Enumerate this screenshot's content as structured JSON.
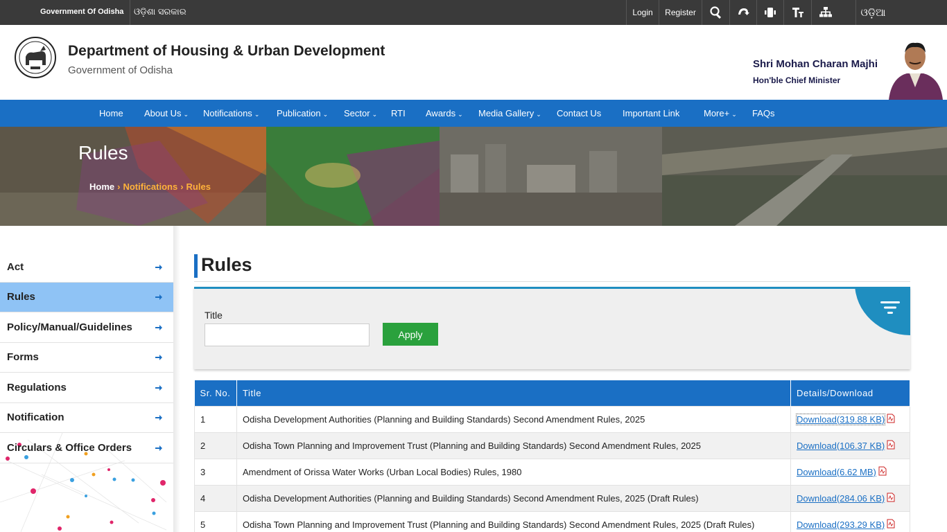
{
  "topbar": {
    "gov_english": "Government Of Odisha",
    "gov_odia": "ଓଡ଼ିଶା ସରକାର",
    "login": "Login",
    "register": "Register",
    "language": "ଓଡ଼ିଆ"
  },
  "header": {
    "title": "Department of Housing & Urban Development",
    "subtitle": "Government of Odisha",
    "cm_name": "Shri Mohan Charan Majhi",
    "cm_title": "Hon'ble Chief Minister"
  },
  "nav": {
    "items": [
      {
        "label": "Home"
      },
      {
        "label": "About Us"
      },
      {
        "label": "Notifications"
      },
      {
        "label": "Publication"
      },
      {
        "label": "Sector"
      },
      {
        "label": "RTI"
      },
      {
        "label": "Awards"
      },
      {
        "label": "Media Gallery"
      },
      {
        "label": "Contact Us"
      },
      {
        "label": "Important Link"
      },
      {
        "label": "More+"
      },
      {
        "label": "FAQs"
      }
    ]
  },
  "banner": {
    "title": "Rules",
    "breadcrumb": [
      "Home",
      "Notifications",
      "Rules"
    ]
  },
  "sidebar": {
    "items": [
      {
        "label": "Act"
      },
      {
        "label": "Rules"
      },
      {
        "label": "Policy/Manual/Guidelines"
      },
      {
        "label": "Forms"
      },
      {
        "label": "Regulations"
      },
      {
        "label": "Notification"
      },
      {
        "label": "Circulars & Office Orders"
      }
    ]
  },
  "main": {
    "heading": "Rules",
    "filter": {
      "title_label": "Title",
      "title_value": "",
      "apply_label": "Apply"
    },
    "table": {
      "headers": [
        "Sr. No.",
        "Title",
        "Details/Download"
      ],
      "rows": [
        {
          "sr": "1",
          "title": "Odisha Development Authorities (Planning and Building Standards) Second Amendment Rules, 2025",
          "download": "Download(319.88 KB)"
        },
        {
          "sr": "2",
          "title": "Odisha Town Planning and Improvement Trust (Planning and Building Standards) Second Amendment Rules, 2025",
          "download": "Download(106.37 KB)"
        },
        {
          "sr": "3",
          "title": "Amendment of Orissa Water Works (Urban Local Bodies) Rules, 1980",
          "download": "Download(6.62 MB)"
        },
        {
          "sr": "4",
          "title": "Odisha Development Authorities (Planning and Building Standards) Second Amendment Rules, 2025 (Draft Rules)",
          "download": "Download(284.06 KB)"
        },
        {
          "sr": "5",
          "title": "Odisha Town Planning and Improvement Trust (Planning and Building Standards) Second Amendment Rules, 2025 (Draft Rules)",
          "download": "Download(293.29 KB)"
        }
      ]
    }
  },
  "colors": {
    "nav_blue": "#1a6fc4",
    "active_sidebar": "#8fc3f5",
    "apply_green": "#2aa13d",
    "breadcrumb_orange": "#ffb23a"
  }
}
